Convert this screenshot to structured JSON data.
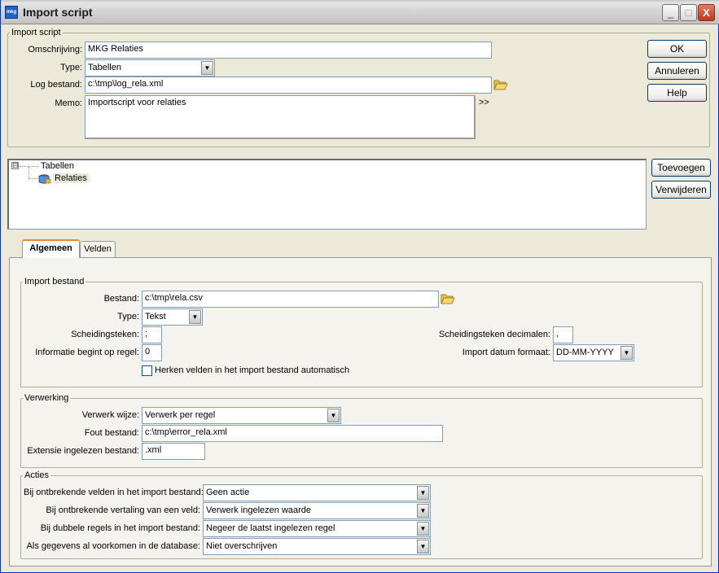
{
  "window": {
    "title": "Import script",
    "icon_label": "mkg",
    "minimize": "_",
    "maximize": "□",
    "close": "X"
  },
  "import_script": {
    "legend": "Import script",
    "omschrijving_label": "Omschrijving:",
    "omschrijving_value": "MKG Relaties",
    "type_label": "Type:",
    "type_value": "Tabellen",
    "log_label": "Log bestand:",
    "log_value": "c:\\tmp\\log_rela.xml",
    "memo_label": "Memo:",
    "memo_value": "Importscript voor relaties",
    "memo_expand": ">>"
  },
  "buttons": {
    "ok": "OK",
    "annuleren": "Annuleren",
    "help": "Help",
    "toevoegen": "Toevoegen",
    "verwijderen": "Verwijderen"
  },
  "tree": {
    "root_toggle": "⊟",
    "root": "Tabellen",
    "child": "Relaties"
  },
  "tabs": [
    {
      "label": "Algemeen",
      "active": true
    },
    {
      "label": "Velden",
      "active": false
    }
  ],
  "import_bestand": {
    "legend": "Import bestand",
    "bestand_label": "Bestand:",
    "bestand_value": "c:\\tmp\\rela.csv",
    "type_label": "Type:",
    "type_value": "Tekst",
    "scheiding_label": "Scheidingsteken:",
    "scheiding_value": ";",
    "info_label": "Informatie begint op regel:",
    "info_value": "0",
    "scheiding_dec_label": "Scheidingsteken decimalen:",
    "scheiding_dec_value": ",",
    "datum_label": "Import datum formaat:",
    "datum_value": "DD-MM-YYYY",
    "herken_label": "Herken velden in het import bestand automatisch",
    "herken_checked": false
  },
  "verwerking": {
    "legend": "Verwerking",
    "wijze_label": "Verwerk wijze:",
    "wijze_value": "Verwerk per regel",
    "fout_label": "Fout bestand:",
    "fout_value": "c:\\tmp\\error_rela.xml",
    "extensie_label": "Extensie ingelezen bestand:",
    "extensie_value": ".xml"
  },
  "acties": {
    "legend": "Acties",
    "rows": [
      {
        "label": "Bij ontbrekende velden in het import bestand:",
        "value": "Geen actie"
      },
      {
        "label": "Bij ontbrekende vertaling van een veld:",
        "value": "Verwerk ingelezen waarde"
      },
      {
        "label": "Bij dubbele regels in het import bestand:",
        "value": "Negeer de laatst ingelezen regel"
      },
      {
        "label": "Als gegevens al voorkomen in de database:",
        "value": "Niet overschrijven"
      }
    ]
  },
  "colors": {
    "face": "#ece9d8",
    "field_border": "#7f9db9",
    "tab_highlight": "#e68b2c"
  }
}
